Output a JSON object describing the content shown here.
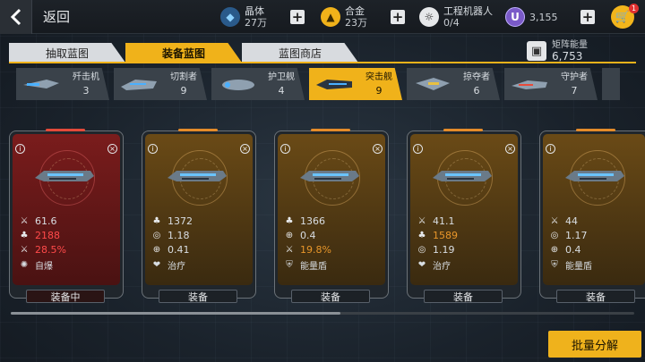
{
  "header": {
    "back_label": "返回"
  },
  "resources": [
    {
      "name": "晶体",
      "value": "27万"
    },
    {
      "name": "合金",
      "value": "23万"
    },
    {
      "name": "工程机器人",
      "value": "0/4"
    }
  ],
  "currency": {
    "value": "3,155",
    "icon_letter": "U"
  },
  "cart": {
    "badge": "1"
  },
  "tabs": [
    {
      "label": "抽取蓝图"
    },
    {
      "label": "装备蓝图"
    },
    {
      "label": "蓝图商店"
    }
  ],
  "matrix": {
    "label": "矩阵能量",
    "value": "6,753"
  },
  "ships": [
    {
      "name": "歼击机",
      "count": "3"
    },
    {
      "name": "切割者",
      "count": "9"
    },
    {
      "name": "护卫舰",
      "count": "4"
    },
    {
      "name": "突击舰",
      "count": "9"
    },
    {
      "name": "掠夺者",
      "count": "6"
    },
    {
      "name": "守护者",
      "count": "7"
    }
  ],
  "cards": [
    {
      "stats": [
        "61.6",
        "2188",
        "28.5%"
      ],
      "skill": "自爆",
      "button": "装备中"
    },
    {
      "stats": [
        "1372",
        "1.18",
        "0.41"
      ],
      "skill": "治疗",
      "button": "装备"
    },
    {
      "stats": [
        "1366",
        "0.4",
        "19.8%"
      ],
      "skill": "能量盾",
      "button": "装备"
    },
    {
      "stats": [
        "41.1",
        "1589",
        "1.19"
      ],
      "skill": "治疗",
      "button": "装备"
    },
    {
      "stats": [
        "44",
        "1.17",
        "0.4"
      ],
      "skill": "能量盾",
      "button": "装备"
    }
  ],
  "batch_button": "批量分解",
  "colors": {
    "accent": "#f0b21a",
    "stat_highlight": "#e8962a",
    "stat_red": "#ff4a4a"
  }
}
